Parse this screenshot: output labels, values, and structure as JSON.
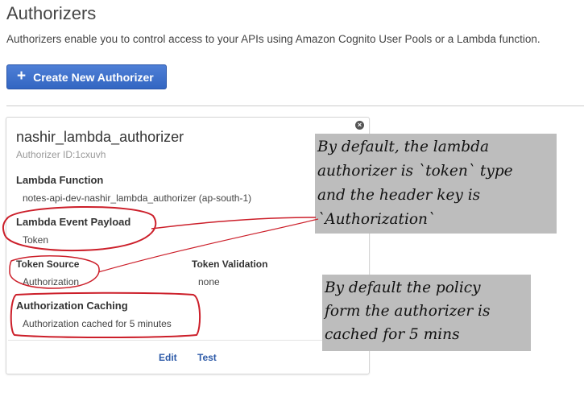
{
  "header": {
    "title": "Authorizers",
    "description": "Authorizers enable you to control access to your APIs using Amazon Cognito User Pools or a Lambda function."
  },
  "create_button": {
    "label": "Create New Authorizer",
    "icon": "plus-icon"
  },
  "authorizer": {
    "name": "nashir_lambda_authorizer",
    "id_text": "Authorizer ID:1cxuvh",
    "lambda_function_label": "Lambda Function",
    "lambda_function_value": "notes-api-dev-nashir_lambda_authorizer (ap-south-1)",
    "event_payload_label": "Lambda Event Payload",
    "event_payload_value": "Token",
    "token_source_label": "Token Source",
    "token_source_value": "Authorization",
    "token_validation_label": "Token Validation",
    "token_validation_value": "none",
    "caching_label": "Authorization Caching",
    "caching_value": "Authorization cached for 5 minutes",
    "edit_label": "Edit",
    "test_label": "Test"
  },
  "annotations": {
    "note1_lines": [
      "By default, the lambda",
      "authorizer is `token` type",
      "and the header key is",
      "`Authorization`"
    ],
    "note2_lines": [
      "By default the policy",
      "form the authorizer is",
      "cached for 5 mins"
    ],
    "note_bg": "#bdbdbd",
    "circle_color": "#cc1f2a"
  },
  "colors": {
    "accent": "#3366c2",
    "link": "#2d5aa8"
  }
}
